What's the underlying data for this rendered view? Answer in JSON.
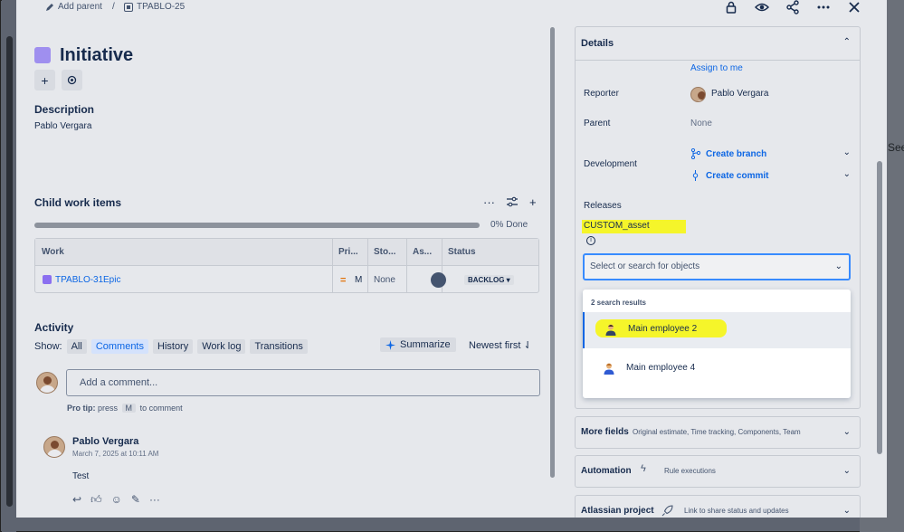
{
  "breadcrumb": {
    "add_parent": "Add parent",
    "separator": "/",
    "issue_key": "TPABLO-25"
  },
  "issue": {
    "title": "Initiative"
  },
  "description": {
    "heading": "Description",
    "text": "Pablo Vergara"
  },
  "child_items": {
    "heading": "Child work items",
    "progress_label": "0% Done",
    "progress_done": 0,
    "columns": [
      "Work",
      "Pri...",
      "Sto...",
      "As...",
      "Status"
    ],
    "rows": [
      {
        "key": "TPABLO-31",
        "type": "Epic",
        "priority": "M",
        "story_points": "None",
        "assignee": "U",
        "status": "BACKLOG"
      }
    ]
  },
  "activity": {
    "heading": "Activity",
    "show_label": "Show:",
    "filters": [
      "All",
      "Comments",
      "History",
      "Work log",
      "Transitions"
    ],
    "active_filter": "Comments",
    "summarize": "Summarize",
    "sort": "Newest first",
    "comment_placeholder": "Add a comment...",
    "protip_bold": "Pro tip:",
    "protip_pre": "press",
    "protip_key": "M",
    "protip_post": "to comment",
    "comment": {
      "author": "Pablo Vergara",
      "date": "March 7, 2025 at 10:11 AM",
      "text": "Test"
    }
  },
  "details": {
    "heading": "Details",
    "assign_to_me": "Assign to me",
    "reporter_label": "Reporter",
    "reporter_value": "Pablo Vergara",
    "parent_label": "Parent",
    "parent_value": "None",
    "development_label": "Development",
    "create_branch": "Create branch",
    "create_commit": "Create commit",
    "releases_label": "Releases",
    "custom_field_label": "CUSTOM_asset",
    "select_placeholder": "Select or search for objects",
    "search_count": "2 search results",
    "results": [
      "Main employee 2",
      "Main employee 4"
    ]
  },
  "sections": {
    "more_fields": {
      "title": "More fields",
      "subtitle": "Original estimate, Time tracking, Components, Team"
    },
    "automation": {
      "title": "Automation",
      "subtitle": "Rule executions"
    },
    "atlassian_project": {
      "title": "Atlassian project",
      "subtitle": "Link to share status and updates"
    }
  },
  "background": {
    "see_text": "See"
  },
  "colors": {
    "accent": "#0c66e4",
    "highlight": "#f5f52a",
    "initiative": "#9f8fef",
    "epic": "#8b6ff0"
  }
}
